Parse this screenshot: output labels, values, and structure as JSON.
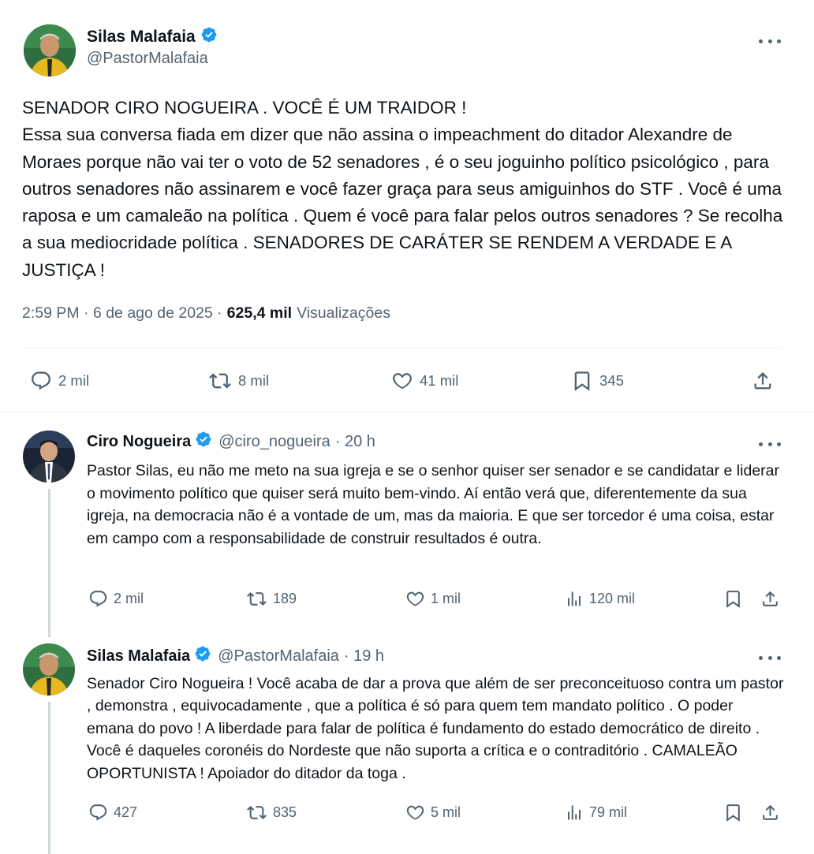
{
  "main_tweet": {
    "author_name": "Silas Malafaia",
    "handle": "@PastorMalafaia",
    "text": "SENADOR CIRO NOGUEIRA . VOCÊ É UM TRAIDOR !\nEssa sua conversa fiada em dizer que não assina o impeachment do ditador Alexandre de Moraes porque não vai ter o voto de 52 senadores , é o seu joguinho político psicológico , para outros senadores não assinarem e você fazer graça para seus amiguinhos do STF . Você é uma raposa e um camaleão na política . Quem é você para falar pelos outros senadores ? Se recolha a sua mediocridade política . SENADORES DE CARÁTER SE RENDEM A VERDADE E A JUSTIÇA !",
    "timestamp": "2:59 PM · 6 de ago de 2025 ·",
    "views_count": "625,4 mil",
    "views_label": "Visualizações",
    "replies": "2 mil",
    "reposts": "8 mil",
    "likes": "41 mil",
    "bookmarks": "345"
  },
  "replies": [
    {
      "author_name": "Ciro Nogueira",
      "handle": "@ciro_nogueira",
      "time": "· 20 h",
      "text": "Pastor Silas, eu não me meto na sua igreja e se o senhor quiser ser senador e se candidatar e liderar o movimento político que quiser será muito bem-vindo. Aí então verá que, diferentemente da sua igreja, na democracia não é a vontade de um, mas da maioria. E que ser torcedor é uma coisa, estar em campo com a responsabilidade de construir resultados é outra.",
      "replies": "2 mil",
      "reposts": "189",
      "likes": "1 mil",
      "views": "120 mil"
    },
    {
      "author_name": "Silas Malafaia",
      "handle": "@PastorMalafaia",
      "time": "· 19 h",
      "text": "Senador Ciro Nogueira ! Você acaba de dar a prova que além de ser preconceituoso contra um pastor , demonstra , equivocadamente , que a política é só para quem tem mandato político . O poder emana do povo ! A liberdade para falar de política é fundamento do estado democrático de direito . Você é daqueles coronéis do Nordeste que não suporta a crítica e o contraditório . CAMALEÃO OPORTUNISTA ! Apoiador do ditador da toga .",
      "replies": "427",
      "reposts": "835",
      "likes": "5 mil",
      "views": "79 mil"
    }
  ],
  "colors": {
    "text": "#0f1419",
    "muted": "#536471",
    "verified": "#1d9bf0",
    "divider": "#eff3f4"
  }
}
